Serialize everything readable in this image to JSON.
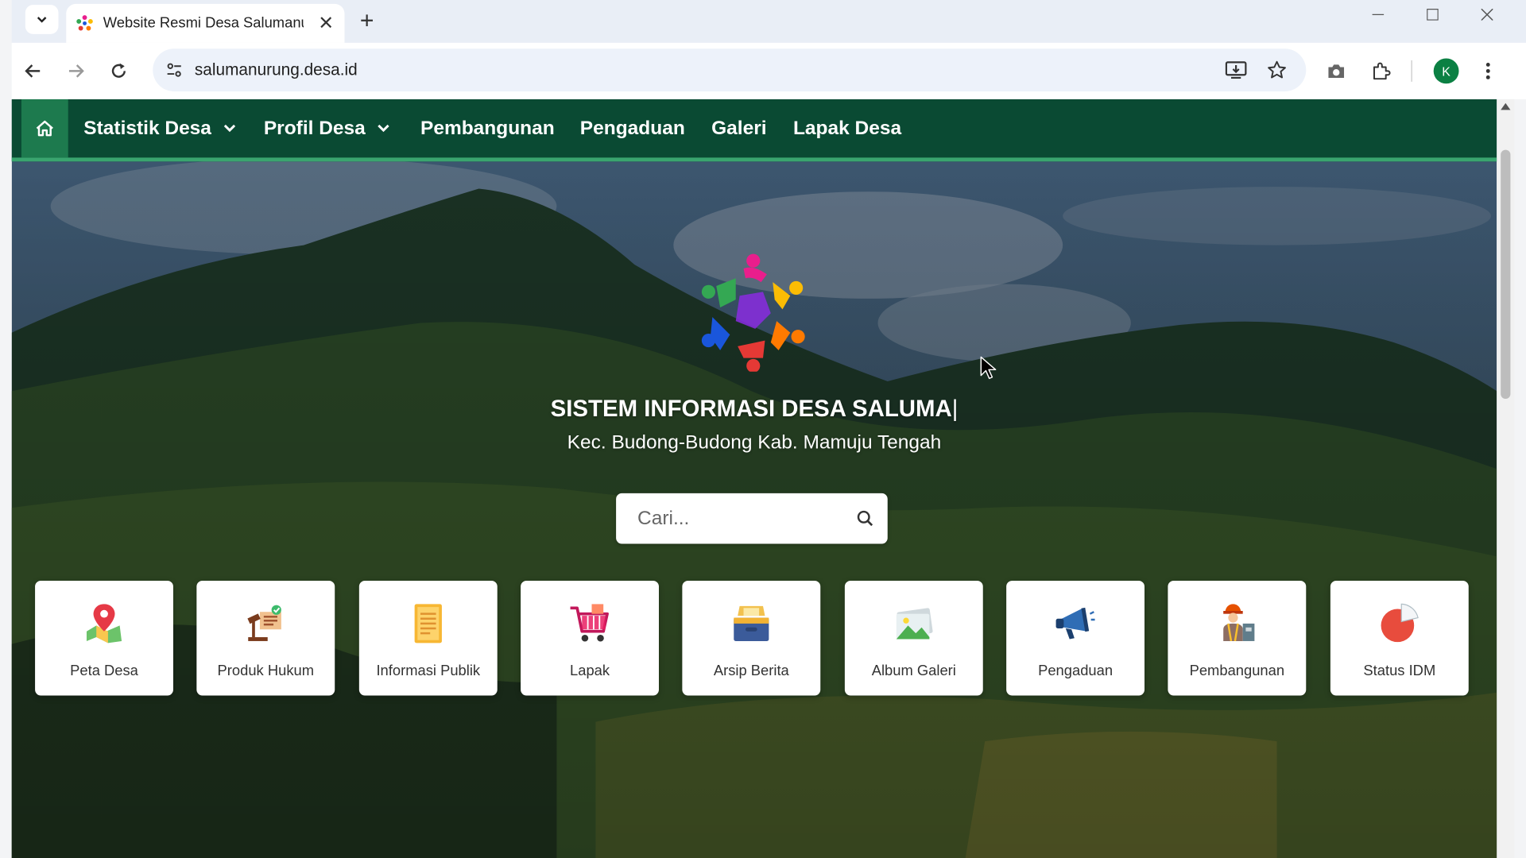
{
  "browser": {
    "tab_title": "Website Resmi Desa Salumanurung",
    "url": "salumanurung.desa.id",
    "profile_initial": "K",
    "icons": [
      "tab-list-icon",
      "close-icon",
      "plus-icon",
      "minimize-icon",
      "maximize-icon",
      "window-close-icon",
      "back-arrow-icon",
      "forward-arrow-icon",
      "reload-icon",
      "site-info-icon",
      "install-app-icon",
      "bookmark-star-icon",
      "camera-icon",
      "extensions-icon",
      "kebab-menu-icon"
    ]
  },
  "site_nav": {
    "items": [
      {
        "label": "Statistik Desa",
        "has_dropdown": true
      },
      {
        "label": "Profil Desa",
        "has_dropdown": true
      },
      {
        "label": "Pembangunan",
        "has_dropdown": false
      },
      {
        "label": "Pengaduan",
        "has_dropdown": false
      },
      {
        "label": "Galeri",
        "has_dropdown": false
      },
      {
        "label": "Lapak Desa",
        "has_dropdown": false
      }
    ],
    "home_icon": "home-icon"
  },
  "hero": {
    "title": "SISTEM INFORMASI DESA SALUMA",
    "title_caret": "|",
    "subtitle": "Kec. Budong-Budong Kab. Mamuju Tengah",
    "search_placeholder": "Cari..."
  },
  "cards": [
    {
      "label": "Peta Desa",
      "icon": "map-pin-icon"
    },
    {
      "label": "Produk Hukum",
      "icon": "law-gavel-icon"
    },
    {
      "label": "Informasi Publik",
      "icon": "document-icon"
    },
    {
      "label": "Lapak",
      "icon": "shopping-cart-icon"
    },
    {
      "label": "Arsip Berita",
      "icon": "archive-box-icon"
    },
    {
      "label": "Album Galeri",
      "icon": "gallery-image-icon"
    },
    {
      "label": "Pengaduan",
      "icon": "megaphone-icon"
    },
    {
      "label": "Pembangunan",
      "icon": "construction-worker-icon"
    },
    {
      "label": "Status IDM",
      "icon": "pie-chart-icon"
    }
  ],
  "colors": {
    "nav_bg": "#0a4a33",
    "nav_accent": "#3aa56f",
    "home_bg": "#1d7a4e"
  }
}
